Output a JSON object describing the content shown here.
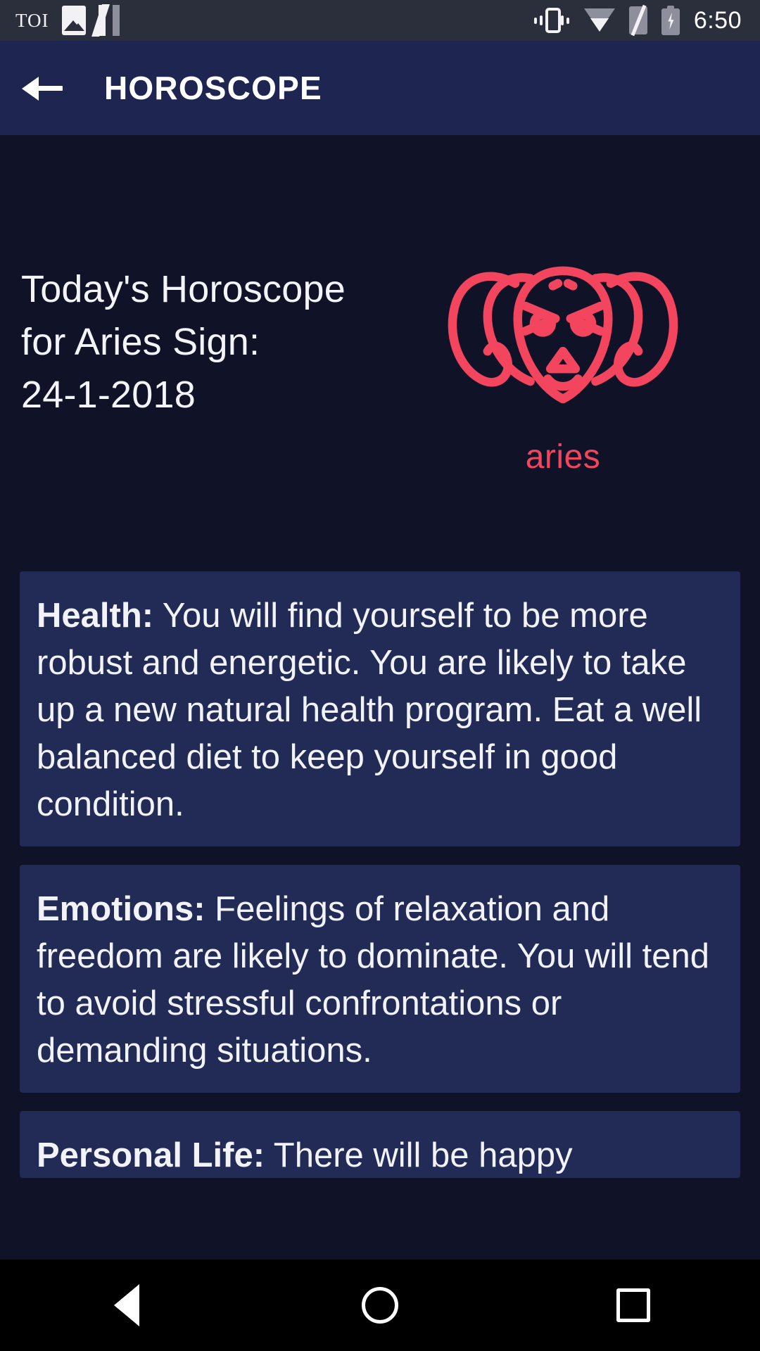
{
  "status_bar": {
    "app_logo": "TOI",
    "icons": [
      "toi-logo",
      "photos-icon",
      "netflix-icon",
      "vibrate-icon",
      "wifi-icon",
      "sim-card-off-icon",
      "battery-charging-icon"
    ],
    "time": "6:50"
  },
  "app_bar": {
    "back_label": "back-arrow",
    "title": "HOROSCOPE"
  },
  "hero": {
    "title_lines": [
      "Today's Horoscope",
      "for Aries Sign:",
      "24-1-2018"
    ],
    "sign_name": "aries",
    "sign_icon": "aries-ram-icon",
    "sign_color": "#f4455e"
  },
  "cards": [
    {
      "label": "Health:",
      "body": " You will find yourself to be more robust and energetic. You are likely to take up a new natural health program. Eat a well balanced diet to keep yourself in good condition.",
      "clipped": false
    },
    {
      "label": "Emotions:",
      "body": " Feelings of relaxation and freedom are likely to dominate. You will tend to avoid stressful confrontations or demanding situations.",
      "clipped": false
    },
    {
      "label": "Personal Life:",
      "body": " There will be happy",
      "clipped": true
    }
  ],
  "nav_bar": {
    "items": [
      "nav-back-button",
      "nav-home-button",
      "nav-recents-button"
    ]
  },
  "colors": {
    "status_bar_bg": "#2b2e3b",
    "app_bar_bg": "#1e2551",
    "page_bg": "#101327",
    "card_bg": "#222b55",
    "accent": "#f4455e",
    "text": "#f2f3f8"
  }
}
